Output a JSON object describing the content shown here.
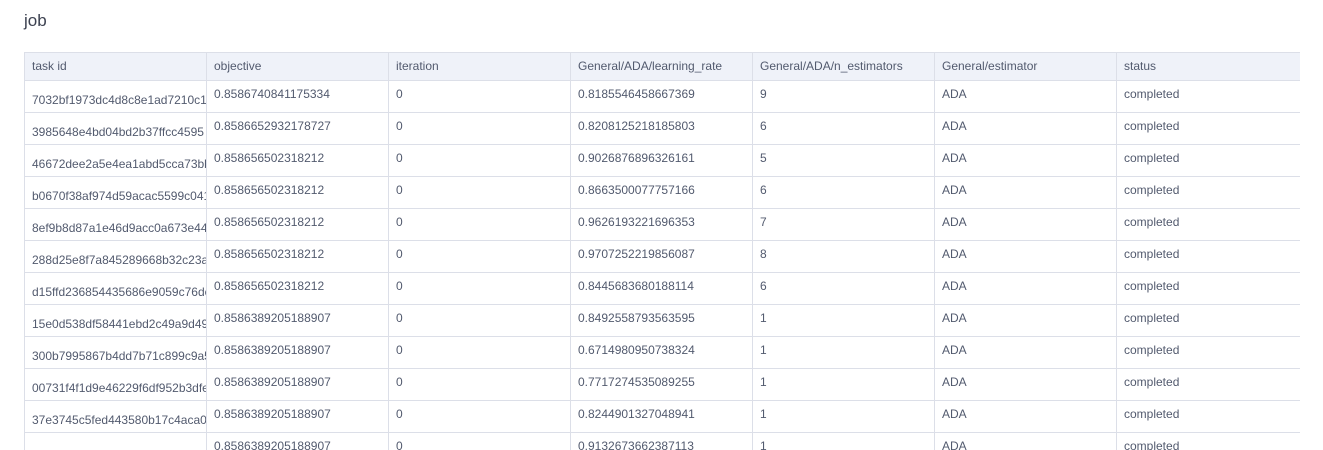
{
  "page": {
    "title": "job"
  },
  "table": {
    "columns": [
      "task id",
      "objective",
      "iteration",
      "General/ADA/learning_rate",
      "General/ADA/n_estimators",
      "General/estimator",
      "status"
    ],
    "rows": [
      [
        "7032bf1973dc4d8c8e1ad7210c1",
        "0.8586740841175334",
        "0",
        "0.8185546458667369",
        "9",
        "ADA",
        "completed"
      ],
      [
        "3985648e4bd04bd2b37ffcc4595",
        "0.8586652932178727",
        "0",
        "0.8208125218185803",
        "6",
        "ADA",
        "completed"
      ],
      [
        "46672dee2a5e4ea1abd5cca73bb",
        "0.858656502318212",
        "0",
        "0.9026876896326161",
        "5",
        "ADA",
        "completed"
      ],
      [
        "b0670f38af974d59acac5599c041",
        "0.858656502318212",
        "0",
        "0.8663500077757166",
        "6",
        "ADA",
        "completed"
      ],
      [
        "8ef9b8d87a1e46d9acc0a673e44",
        "0.858656502318212",
        "0",
        "0.9626193221696353",
        "7",
        "ADA",
        "completed"
      ],
      [
        "288d25e8f7a845289668b32c23a",
        "0.858656502318212",
        "0",
        "0.9707252219856087",
        "8",
        "ADA",
        "completed"
      ],
      [
        "d15ffd236854435686e9059c76dc",
        "0.858656502318212",
        "0",
        "0.8445683680188114",
        "6",
        "ADA",
        "completed"
      ],
      [
        "15e0d538df58441ebd2c49a9d49",
        "0.8586389205188907",
        "0",
        "0.8492558793563595",
        "1",
        "ADA",
        "completed"
      ],
      [
        "300b7995867b4dd7b71c899c9a5",
        "0.8586389205188907",
        "0",
        "0.6714980950738324",
        "1",
        "ADA",
        "completed"
      ],
      [
        "00731f4f1d9e46229f6df952b3dfe",
        "0.8586389205188907",
        "0",
        "0.7717274535089255",
        "1",
        "ADA",
        "completed"
      ],
      [
        "37e3745c5fed443580b17c4aca0",
        "0.8586389205188907",
        "0",
        "0.8244901327048941",
        "1",
        "ADA",
        "completed"
      ],
      [
        "",
        "0.8586389205188907",
        "0",
        "0.9132673662387113",
        "1",
        "ADA",
        "completed"
      ]
    ]
  }
}
